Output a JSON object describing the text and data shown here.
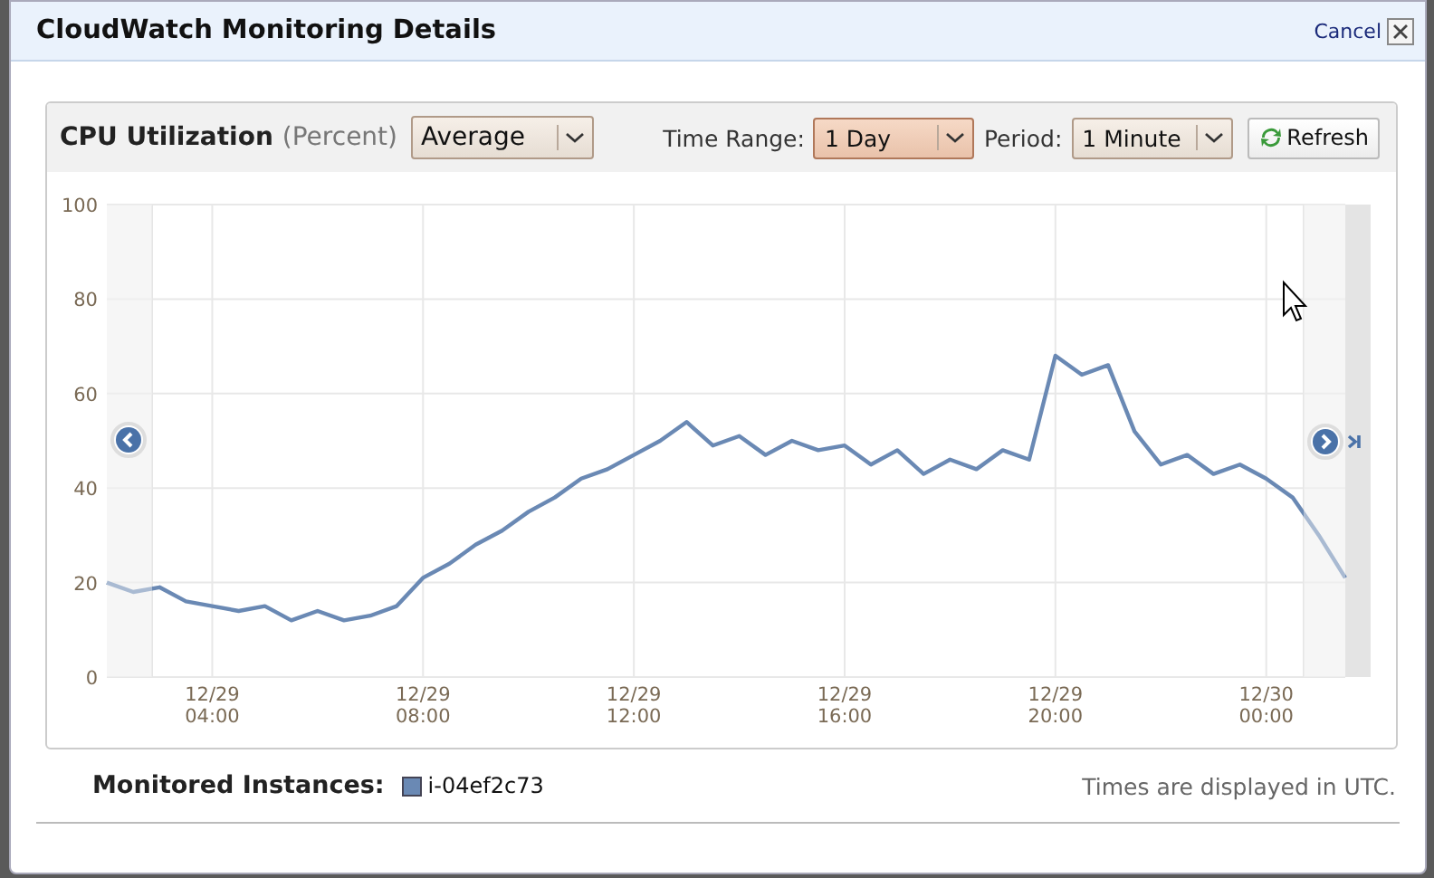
{
  "dialog": {
    "title": "CloudWatch Monitoring Details",
    "cancel_label": "Cancel"
  },
  "metric_panel": {
    "title": "CPU Utilization",
    "unit": "(Percent)",
    "controls": [
      {
        "kind": "select",
        "value": "Average",
        "focused": false
      },
      {
        "kind": "label",
        "text": "Time Range:"
      },
      {
        "kind": "select",
        "value": "1 Day",
        "focused": true
      },
      {
        "kind": "label",
        "text": "Period:"
      },
      {
        "kind": "select",
        "value": "1 Minute",
        "focused": false
      },
      {
        "kind": "button",
        "text": "Refresh"
      }
    ],
    "chart_data": {
      "type": "line",
      "grid": true,
      "ylim": [
        0,
        100
      ],
      "yticks": [
        0,
        20,
        40,
        60,
        80,
        100
      ],
      "categories": [
        null,
        null,
        null,
        null,
        "12/29 04:00",
        null,
        null,
        null,
        null,
        null,
        null,
        null,
        "12/29 08:00",
        null,
        null,
        null,
        null,
        null,
        null,
        null,
        "12/29 12:00",
        null,
        null,
        null,
        null,
        null,
        null,
        null,
        "12/29 16:00",
        null,
        null,
        null,
        null,
        null,
        null,
        null,
        "12/29 20:00",
        null,
        null,
        null,
        null,
        null,
        null,
        null,
        "12/30 00:00",
        null,
        null,
        null
      ],
      "series": [
        {
          "name": "i-04ef2c73",
          "color": "#6a89b4",
          "values": [
            20,
            18,
            19,
            16,
            15,
            14,
            15,
            12,
            14,
            12,
            13,
            15,
            21,
            24,
            28,
            31,
            35,
            38,
            42,
            44,
            47,
            50,
            54,
            49,
            51,
            47,
            50,
            48,
            49,
            45,
            48,
            43,
            46,
            44,
            48,
            46,
            68,
            64,
            66,
            52,
            45,
            47,
            43,
            45,
            42,
            38,
            30,
            21
          ]
        }
      ]
    }
  },
  "footer": {
    "label": "Monitored Instances:",
    "note": "Times are displayed in UTC."
  }
}
